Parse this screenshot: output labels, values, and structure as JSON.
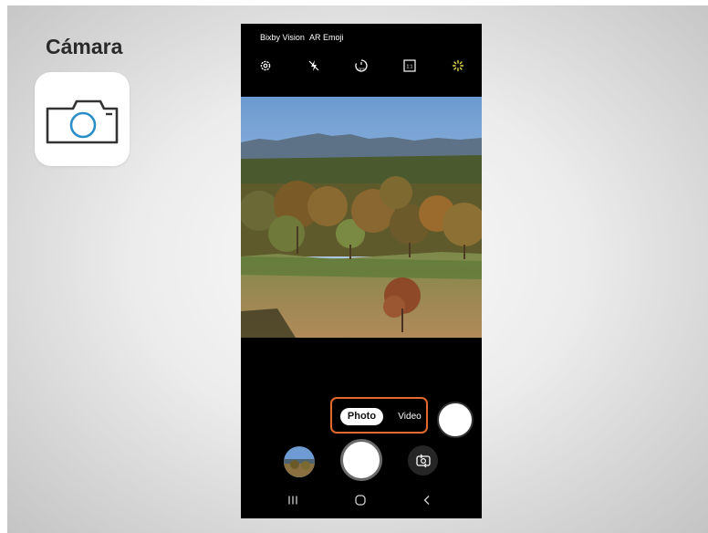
{
  "slide": {
    "title": "Cámara",
    "app_icon": "camera-app-icon"
  },
  "camera": {
    "top_links": [
      "Bixby Vision",
      "AR Emoji"
    ],
    "controls": [
      "settings-icon",
      "flash-off-icon",
      "timer-off-icon",
      "aspect-ratio-icon",
      "filters-icon"
    ],
    "aspect_ratio_label": "1:1",
    "timer_label": "OFF",
    "modes": {
      "photo": "Photo",
      "video": "Video"
    },
    "selected_mode": "Photo",
    "highlight_color": "#e26a2c",
    "nav": [
      "recent-apps-icon",
      "home-icon",
      "back-icon"
    ]
  }
}
